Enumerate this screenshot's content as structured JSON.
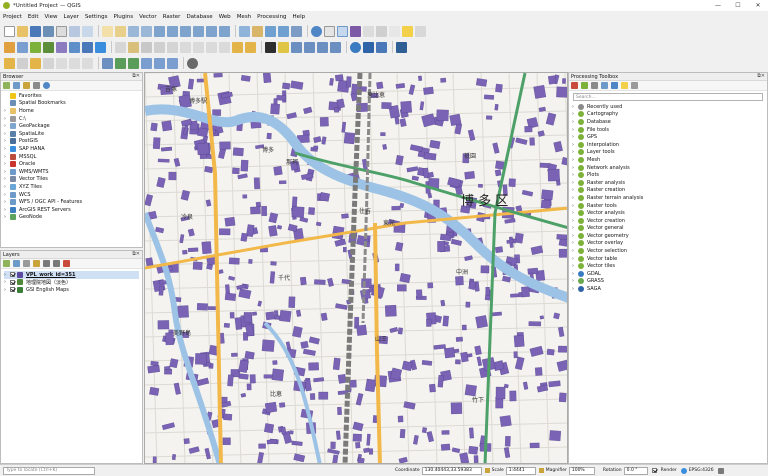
{
  "window": {
    "title": "*Untitled Project — QGIS",
    "controls": [
      "—",
      "☐",
      "✕"
    ]
  },
  "menu": [
    "Project",
    "Edit",
    "View",
    "Layer",
    "Settings",
    "Plugins",
    "Vector",
    "Raster",
    "Database",
    "Web",
    "Mesh",
    "Processing",
    "Help"
  ],
  "browser": {
    "title": "Browser",
    "items": [
      {
        "label": "Favorites",
        "icon": "star-icon",
        "color": "#f0c419"
      },
      {
        "label": "Spatial Bookmarks",
        "icon": "bookmark-icon",
        "color": "#6b8fb5"
      },
      {
        "label": "Home",
        "icon": "folder-icon",
        "color": "#e8c266"
      },
      {
        "label": "C:\\",
        "icon": "drive-icon",
        "color": "#9a9a9a"
      },
      {
        "label": "GeoPackage",
        "icon": "geopackage-icon",
        "color": "#7ea6cf"
      },
      {
        "label": "SpatiaLite",
        "icon": "spatialite-icon",
        "color": "#5a7fa8"
      },
      {
        "label": "PostGIS",
        "icon": "postgis-icon",
        "color": "#4a6e9a"
      },
      {
        "label": "SAP HANA",
        "icon": "saphana-icon",
        "color": "#3b8ede"
      },
      {
        "label": "MSSQL",
        "icon": "mssql-icon",
        "color": "#b94c3c"
      },
      {
        "label": "Oracle",
        "icon": "oracle-icon",
        "color": "#c9352c"
      },
      {
        "label": "WMS/WMTS",
        "icon": "wms-icon",
        "color": "#6d9ac8"
      },
      {
        "label": "Vector Tiles",
        "icon": "vectortiles-icon",
        "color": "#7b89a6"
      },
      {
        "label": "XYZ Tiles",
        "icon": "xyztiles-icon",
        "color": "#6aa5d8"
      },
      {
        "label": "WCS",
        "icon": "wcs-icon",
        "color": "#6d9ac8"
      },
      {
        "label": "WFS / OGC API - Features",
        "icon": "wfs-icon",
        "color": "#6d9ac8"
      },
      {
        "label": "ArcGIS REST Servers",
        "icon": "arcgis-icon",
        "color": "#3c7fc1"
      },
      {
        "label": "GeoNode",
        "icon": "geonode-icon",
        "color": "#5da35d"
      }
    ]
  },
  "layers": {
    "title": "Layers",
    "items": [
      {
        "label": "VPL_work_id=351",
        "color": "#5b4aa0",
        "selected": true
      },
      {
        "label": "地理院地図（淡色）",
        "color": "#4e8a3a",
        "selected": false
      },
      {
        "label": "GSI English Maps",
        "color": "#3b7f3b",
        "selected": false
      }
    ]
  },
  "toolbox": {
    "title": "Processing Toolbox",
    "search_placeholder": "Search…",
    "items": [
      {
        "label": "Recently used",
        "icon": "clock-icon",
        "color": "#8a8a8a"
      },
      {
        "label": "Cartography",
        "icon": "qgis-algorithm-icon",
        "color": "#7db23a"
      },
      {
        "label": "Database",
        "icon": "qgis-algorithm-icon",
        "color": "#7db23a"
      },
      {
        "label": "File tools",
        "icon": "qgis-algorithm-icon",
        "color": "#7db23a"
      },
      {
        "label": "GPS",
        "icon": "qgis-algorithm-icon",
        "color": "#7db23a"
      },
      {
        "label": "Interpolation",
        "icon": "qgis-algorithm-icon",
        "color": "#7db23a"
      },
      {
        "label": "Layer tools",
        "icon": "qgis-algorithm-icon",
        "color": "#7db23a"
      },
      {
        "label": "Mesh",
        "icon": "qgis-algorithm-icon",
        "color": "#7db23a"
      },
      {
        "label": "Network analysis",
        "icon": "qgis-algorithm-icon",
        "color": "#7db23a"
      },
      {
        "label": "Plots",
        "icon": "qgis-algorithm-icon",
        "color": "#7db23a"
      },
      {
        "label": "Raster analysis",
        "icon": "qgis-algorithm-icon",
        "color": "#7db23a"
      },
      {
        "label": "Raster creation",
        "icon": "qgis-algorithm-icon",
        "color": "#7db23a"
      },
      {
        "label": "Raster terrain analysis",
        "icon": "qgis-algorithm-icon",
        "color": "#7db23a"
      },
      {
        "label": "Raster tools",
        "icon": "qgis-algorithm-icon",
        "color": "#7db23a"
      },
      {
        "label": "Vector analysis",
        "icon": "qgis-algorithm-icon",
        "color": "#7db23a"
      },
      {
        "label": "Vector creation",
        "icon": "qgis-algorithm-icon",
        "color": "#7db23a"
      },
      {
        "label": "Vector general",
        "icon": "qgis-algorithm-icon",
        "color": "#7db23a"
      },
      {
        "label": "Vector geometry",
        "icon": "qgis-algorithm-icon",
        "color": "#7db23a"
      },
      {
        "label": "Vector overlay",
        "icon": "qgis-algorithm-icon",
        "color": "#7db23a"
      },
      {
        "label": "Vector selection",
        "icon": "qgis-algorithm-icon",
        "color": "#7db23a"
      },
      {
        "label": "Vector table",
        "icon": "qgis-algorithm-icon",
        "color": "#7db23a"
      },
      {
        "label": "Vector tiles",
        "icon": "qgis-algorithm-icon",
        "color": "#7db23a"
      },
      {
        "label": "GDAL",
        "icon": "gdal-icon",
        "color": "#3a7ac0"
      },
      {
        "label": "GRASS",
        "icon": "grass-icon",
        "color": "#6aa84f"
      },
      {
        "label": "SAGA",
        "icon": "saga-icon",
        "color": "#2f64a8"
      }
    ]
  },
  "map": {
    "district_label": "博 多 区",
    "place_labels": [
      "吉塚",
      "博多",
      "住吉",
      "中洲",
      "美野島",
      "比恵",
      "東比恵",
      "祇園",
      "冷泉",
      "千代",
      "山王",
      "竹下",
      "博多駅",
      "那珂",
      "東光"
    ],
    "colors": {
      "background": "#f4f3ef",
      "building_fill": "#7a63b5",
      "building_stroke": "#4a3a85",
      "river": "#9cc3e6",
      "main_road": "#f2b94a",
      "expressway": "#4da168",
      "rail": "#7a7a7a"
    }
  },
  "status": {
    "locate_placeholder": "Type to locate (Ctrl+K)",
    "coordinate_label": "Coordinate",
    "coordinate_value": "130.40443,33.59383",
    "scale_label": "Scale",
    "scale_value": "1:4441",
    "magnifier_label": "Magnifier",
    "magnifier_value": "100%",
    "rotation_label": "Rotation",
    "rotation_value": "0.0 °",
    "render_label": "Render",
    "crs_label": "EPSG:4326"
  }
}
